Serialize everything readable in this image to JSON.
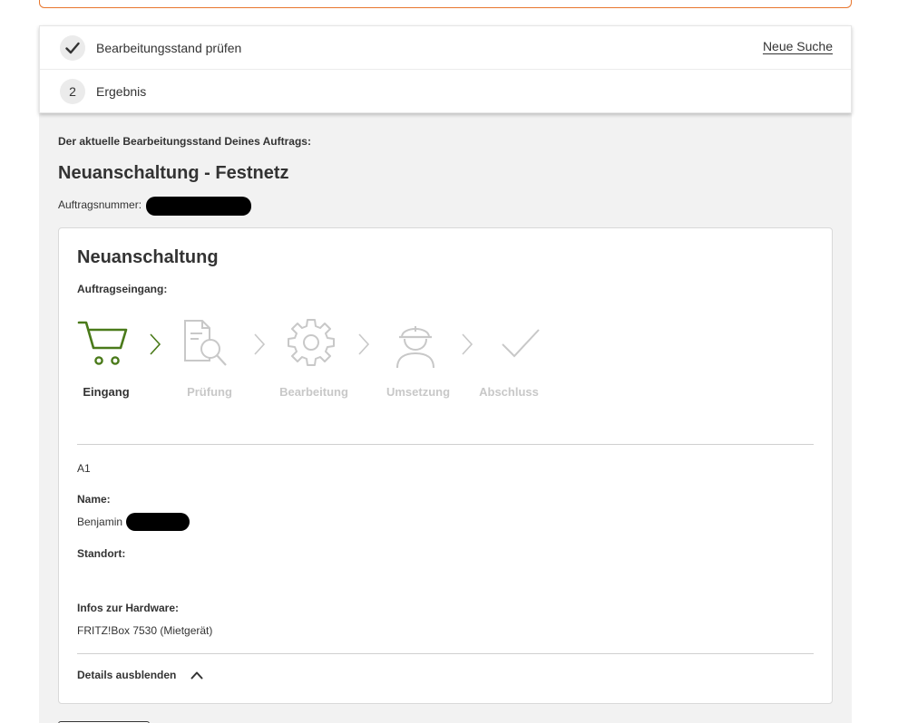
{
  "stepper": {
    "step1": {
      "label": "Bearbeitungsstand prüfen",
      "icon": "checkmark-icon"
    },
    "step2": {
      "number": "2",
      "label": "Ergebnis"
    },
    "new_search": "Neue Suche"
  },
  "main": {
    "intro": "Der aktuelle Bearbeitungsstand Deines Auftrags:",
    "title": "Neuanschaltung - Festnetz",
    "order_number_label": "Auftragsnummer:"
  },
  "card": {
    "title": "Neuanschaltung",
    "status_heading": "Auftragseingang:",
    "steps": [
      {
        "label": "Eingang",
        "icon": "shopping-cart-icon",
        "active": true
      },
      {
        "label": "Prüfung",
        "icon": "document-search-icon",
        "active": false
      },
      {
        "label": "Bearbeitung",
        "icon": "gear-icon",
        "active": false
      },
      {
        "label": "Umsetzung",
        "icon": "worker-helmet-icon",
        "active": false
      },
      {
        "label": "Abschluss",
        "icon": "checkmark-icon",
        "active": false
      }
    ],
    "code": "A1",
    "name_label": "Name:",
    "name_value": "Benjamin",
    "location_label": "Standort:",
    "hardware_label": "Infos zur Hardware:",
    "hardware_value": "FRITZ!Box 7530 (Mietgerät)",
    "toggle_label": "Details ausblenden",
    "toggle_icon": "chevron-up-icon"
  },
  "colors": {
    "active_green": "#4a7a1a",
    "inactive_gray": "#c8c8c8",
    "panel_bg": "#f2f2f2",
    "alert_orange": "#e8762d"
  }
}
